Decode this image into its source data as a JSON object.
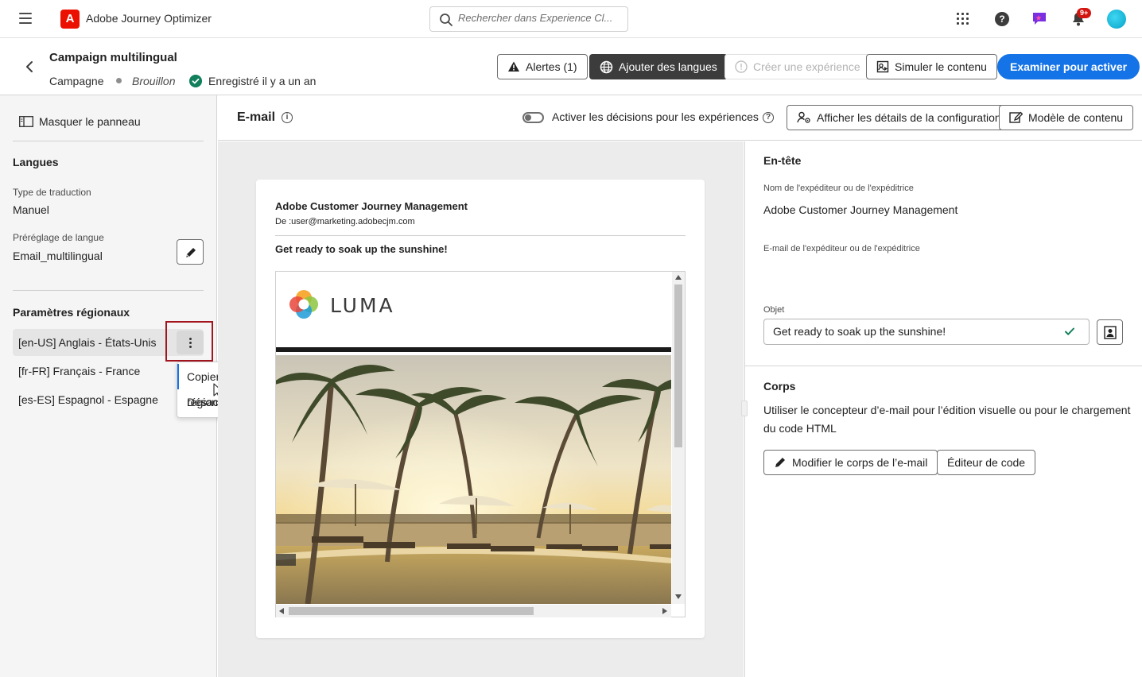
{
  "app": {
    "name": "Adobe Journey Optimizer",
    "logo_letter": "A",
    "search_placeholder": "Rechercher dans Experience Cl...",
    "notification_badge": "9+"
  },
  "header": {
    "title": "Campaign multilingual",
    "type": "Campagne",
    "status": "Brouillon",
    "saved": "Enregistré il y a un an",
    "buttons": {
      "alerts": "Alertes (1)",
      "add_languages": "Ajouter des langues",
      "create_experience": "Créer une expérience",
      "simulate": "Simuler le contenu",
      "review": "Examiner pour activer"
    }
  },
  "left_panel": {
    "hide_panel": "Masquer le panneau",
    "languages_heading": "Langues",
    "translation_type_label": "Type de traduction",
    "translation_type_value": "Manuel",
    "language_preset_label": "Préréglage de langue",
    "language_preset_value": "Email_multilingual",
    "locales_heading": "Paramètres régionaux",
    "locales": [
      {
        "label": "[en-US] Anglais - États-Unis"
      },
      {
        "label": "[fr-FR] Français - France"
      },
      {
        "label": "[es-ES] Espagnol - Espagne"
      }
    ],
    "context_menu": [
      {
        "label": "Copier vers d’autres paramètres régionaux"
      },
      {
        "label": "Désactiver les paramètres régionaux"
      }
    ]
  },
  "subbar": {
    "title": "E-mail",
    "toggle_label": "Activer les décisions pour les expériences",
    "config_button": "Afficher les détails de la configuration",
    "template_button": "Modèle de contenu"
  },
  "preview": {
    "sender_name": "Adobe Customer Journey Management",
    "from": "De :user@marketing.adobecjm.com",
    "subject": "Get ready to soak up the sunshine!",
    "brand": "LUMA"
  },
  "right_panel": {
    "header_heading": "En-tête",
    "sender_name_label": "Nom de l'expéditeur ou de l'expéditrice",
    "sender_name_value": "Adobe Customer Journey Management",
    "sender_email_label": "E-mail de l'expéditeur ou de l'expéditrice",
    "subject_label": "Objet",
    "subject_value": "Get ready to soak up the sunshine!",
    "body_heading": "Corps",
    "body_desc_line1": "Utiliser le concepteur d’e-mail pour l’édition visuelle ou pour le chargement",
    "body_desc_line2": "du  code HTML",
    "edit_body_button": "Modifier le corps de l’e-mail",
    "code_editor_button": "Éditeur de code"
  },
  "colors": {
    "primary": "#1473e6",
    "dark_button": "#3c3c3c",
    "saved_green": "#12805c",
    "highlight_red": "#a3151e",
    "adobe_red": "#eb1000"
  }
}
